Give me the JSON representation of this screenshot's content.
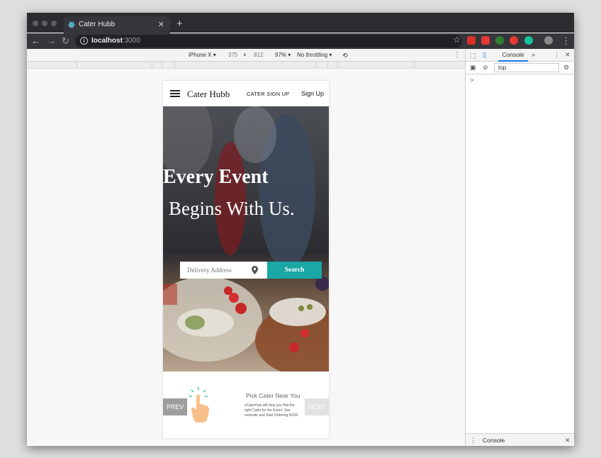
{
  "browser": {
    "tab_title": "Cater Hubb",
    "tab_close": "✕",
    "new_tab": "+",
    "url_host": "localhost",
    "url_port": ":3000",
    "star": "☆"
  },
  "device_toolbar": {
    "device": "iPhone X ▾",
    "width": "375",
    "times": "×",
    "height": "812",
    "zoom": "97% ▾",
    "throttle": "No throttling ▾"
  },
  "devtools": {
    "tab_console": "Console",
    "more_tabs": "»",
    "context": "top",
    "prompt": ">",
    "drawer_label": "Console"
  },
  "app": {
    "brand": "Cater Hubb",
    "cater_signup": "CATER SIGN UP",
    "signup": "Sign Up",
    "hero_line1": "Every Event",
    "hero_line2": "Begins With Us.",
    "search_placeholder": "Delivery Address",
    "search_button": "Search",
    "prev": "PREV",
    "next": "NEXT",
    "slide_title": "Pick Cater Near You",
    "slide_text": "eCaterHub will help you find the right Cater for the Event. See estimate and Start Ordering NOW."
  }
}
